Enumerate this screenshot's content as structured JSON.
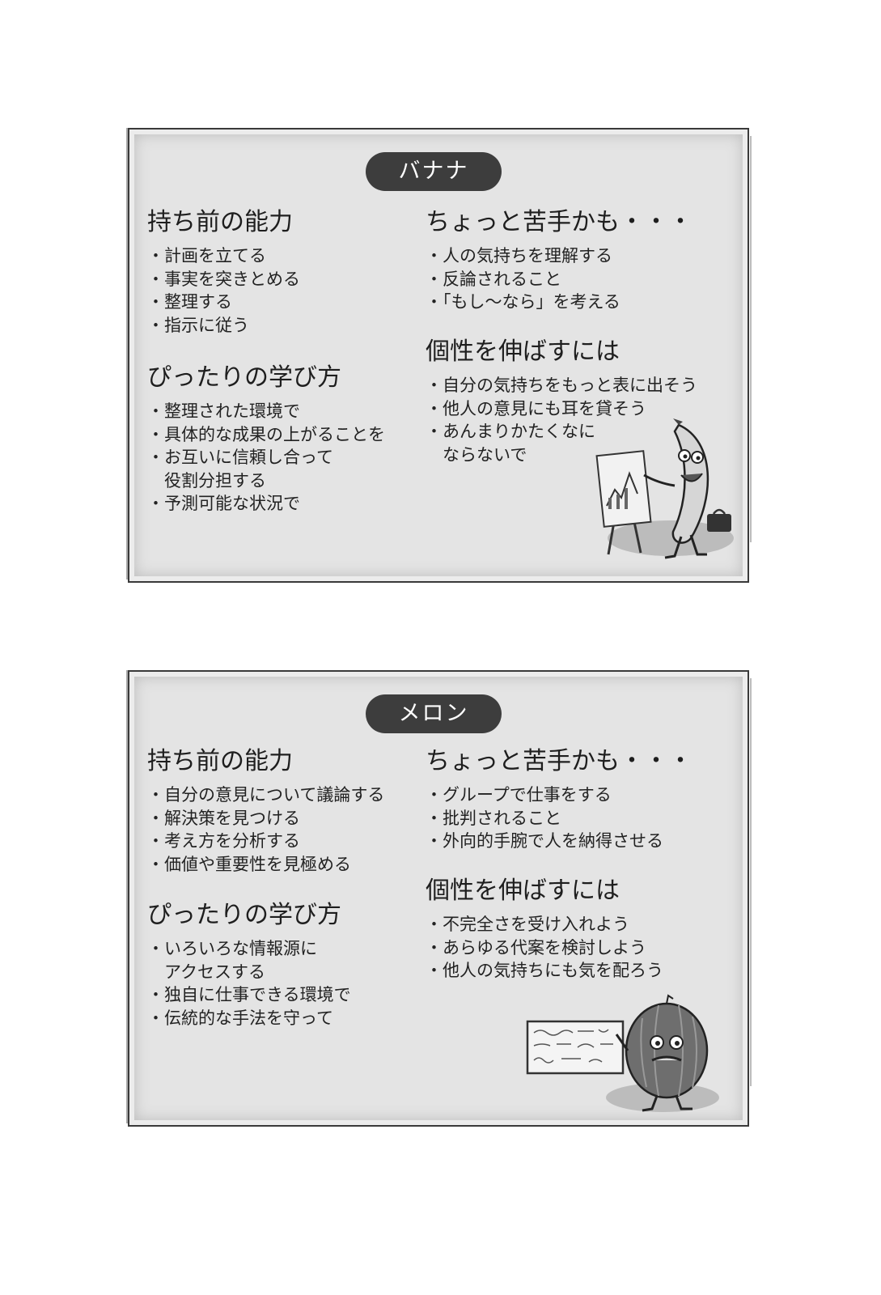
{
  "cards": [
    {
      "title": "バナナ",
      "abilities_heading": "持ち前の能力",
      "abilities": [
        "計画を立てる",
        "事実を突きとめる",
        "整理する",
        "指示に従う"
      ],
      "learning_heading": "ぴったりの学び方",
      "learning": [
        "整理された環境で",
        "具体的な成果の上がることを",
        "お互いに信頼し合って",
        "役割分担する",
        "予測可能な状況で"
      ],
      "weak_heading": "ちょっと苦手かも・・・",
      "weak": [
        "人の気持ちを理解する",
        "反論されること",
        "「もし～なら」を考える"
      ],
      "grow_heading": "個性を伸ばすには",
      "grow": [
        "自分の気持ちをもっと表に出そう",
        "他人の意見にも耳を貸そう",
        "あんまりかたくなに",
        "ならないで"
      ]
    },
    {
      "title": "メロン",
      "abilities_heading": "持ち前の能力",
      "abilities": [
        "自分の意見について議論する",
        "解決策を見つける",
        "考え方を分析する",
        "価値や重要性を見極める"
      ],
      "learning_heading": "ぴったりの学び方",
      "learning": [
        "いろいろな情報源に",
        "アクセスする",
        "独自に仕事できる環境で",
        "伝統的な手法を守って"
      ],
      "weak_heading": "ちょっと苦手かも・・・",
      "weak": [
        "グループで仕事をする",
        "批判されること",
        "外向的手腕で人を納得させる"
      ],
      "grow_heading": "個性を伸ばすには",
      "grow": [
        "不完全さを受け入れよう",
        "あらゆる代案を検討しよう",
        "他人の気持ちにも気を配ろう"
      ]
    }
  ],
  "illustrations": {
    "banana": "banana-character-with-chart-easel-illustration",
    "melon": "melon-character-with-chalkboard-illustration"
  }
}
